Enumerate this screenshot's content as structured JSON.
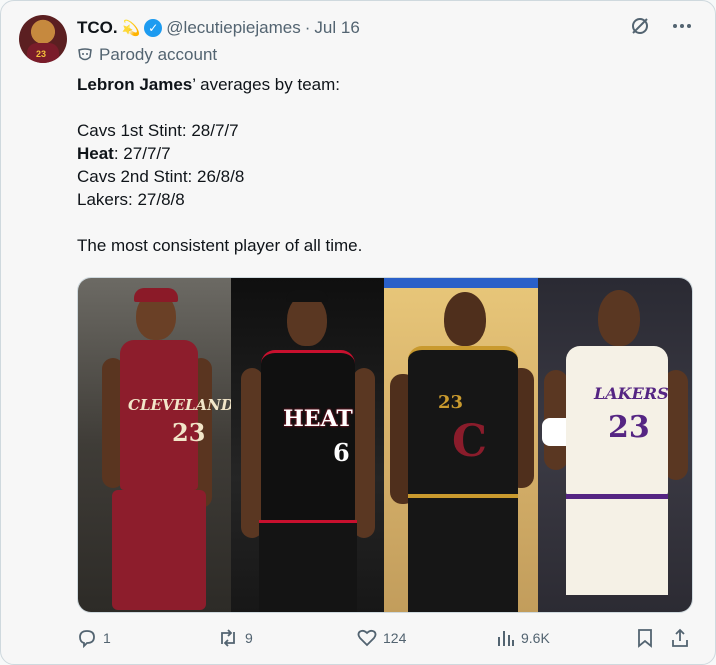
{
  "tweet": {
    "author_name": "TCO.",
    "emoji": "💫",
    "handle": "@lecutiepiejames",
    "separator": "·",
    "date": "Jul 16",
    "parody_label": "Parody account",
    "avatar_number": "23",
    "text": {
      "line1_bold": "Lebron James",
      "line1_rest": "’ averages by team:",
      "stint1": "Cavs 1st Stint: 28/7/7",
      "heat_bold": "Heat",
      "heat_rest": ": 27/7/7",
      "stint2": "Cavs 2nd Stint: 26/8/8",
      "lakers": "Lakers: 27/8/8",
      "closing": "The most consistent player of all time."
    },
    "media": {
      "panels": [
        {
          "jersey": "CLEVELAND",
          "number": "23"
        },
        {
          "jersey": "HEAT",
          "number": "6"
        },
        {
          "jersey": "C",
          "number": "23"
        },
        {
          "jersey": "LAKERS",
          "number": "23"
        }
      ]
    },
    "actions": {
      "replies": "1",
      "reposts": "9",
      "likes": "124",
      "views": "9.6K"
    }
  },
  "icons": {
    "verified": "verified-badge-icon",
    "parody": "parody-mask-icon",
    "grok": "grok-icon",
    "more": "more-icon",
    "reply": "reply-icon",
    "repost": "repost-icon",
    "like": "heart-icon",
    "views": "views-icon",
    "bookmark": "bookmark-icon",
    "share": "share-icon"
  },
  "colors": {
    "accent": "#1d9bf0",
    "muted": "#536471",
    "text": "#0f1419"
  }
}
